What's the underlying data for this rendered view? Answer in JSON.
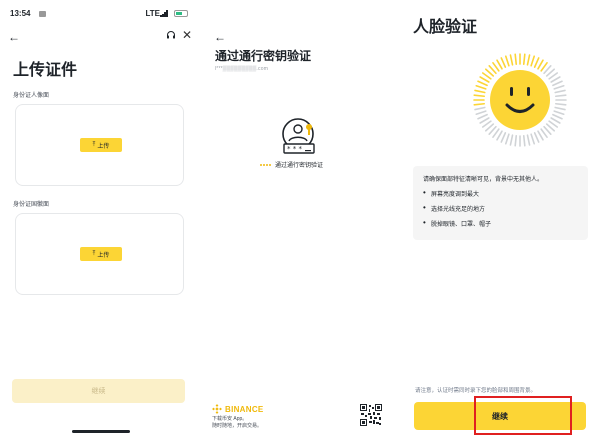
{
  "upload_screen": {
    "status_time": "13:54",
    "network": "LTE",
    "title": "上传证件",
    "front_label": "身份证人像面",
    "back_label": "身份证国徽面",
    "upload_label": "上传",
    "continue_label": "继续"
  },
  "passkey_screen": {
    "title": "通过通行密钥验证",
    "email_masked": "l***▒▒▒▒▒▒▒▒▒.com",
    "status_text": "通过通行密钥验证",
    "brand": "BINANCE",
    "brand_desc_line1": "下载币安 App。",
    "brand_desc_line2": "随时随地，开启交易。"
  },
  "face_screen": {
    "title": "人脸验证",
    "instructions_head": "请确保面部特征清晰可见，背景中无其他人。",
    "instructions": [
      "屏幕亮度调到最大",
      "选择光线充足的地方",
      "脱掉眼镜、口罩、帽子"
    ],
    "notice": "请注意，认证时需同时录下您的脸部和周围背景。",
    "continue_label": "继续"
  },
  "colors": {
    "brand_yellow": "#fcd535",
    "highlight_red": "#e02020",
    "disabled_yellow": "#fbf0c8"
  }
}
